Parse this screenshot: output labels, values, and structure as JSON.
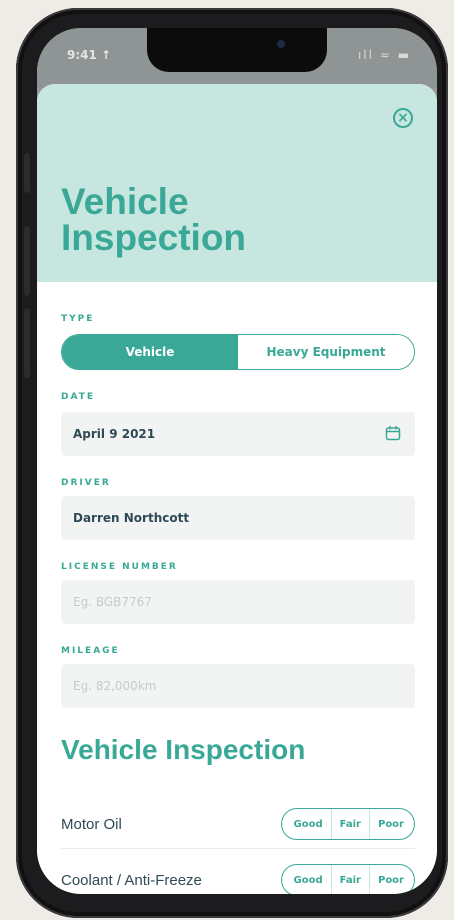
{
  "status_bar": {
    "time": "9:41 ↑",
    "icons": "ıll ≈ ▬"
  },
  "header": {
    "title": "Vehicle Inspection",
    "close_icon": "close-circle-icon"
  },
  "form": {
    "type_label": "TYPE",
    "type_options": [
      "Vehicle",
      "Heavy Equipment"
    ],
    "type_selected": "Vehicle",
    "date_label": "DATE",
    "date_value": "April 9 2021",
    "driver_label": "DRIVER",
    "driver_value": "Darren Northcott",
    "license_label": "LICENSE NUMBER",
    "license_placeholder": "Eg. BGB7767",
    "mileage_label": "MILEAGE",
    "mileage_placeholder": "Eg. 82,000km"
  },
  "inspection": {
    "title": "Vehicle Inspection",
    "items": [
      {
        "label": "Motor Oil",
        "options": [
          "Good",
          "Fair",
          "Poor"
        ]
      },
      {
        "label": "Coolant / Anti-Freeze",
        "options": [
          "Good",
          "Fair",
          "Poor"
        ]
      }
    ]
  },
  "colors": {
    "accent": "#3aa896",
    "header_bg": "#c8e6e0",
    "field_bg": "#f2f4f3",
    "text": "#2f4a55"
  }
}
